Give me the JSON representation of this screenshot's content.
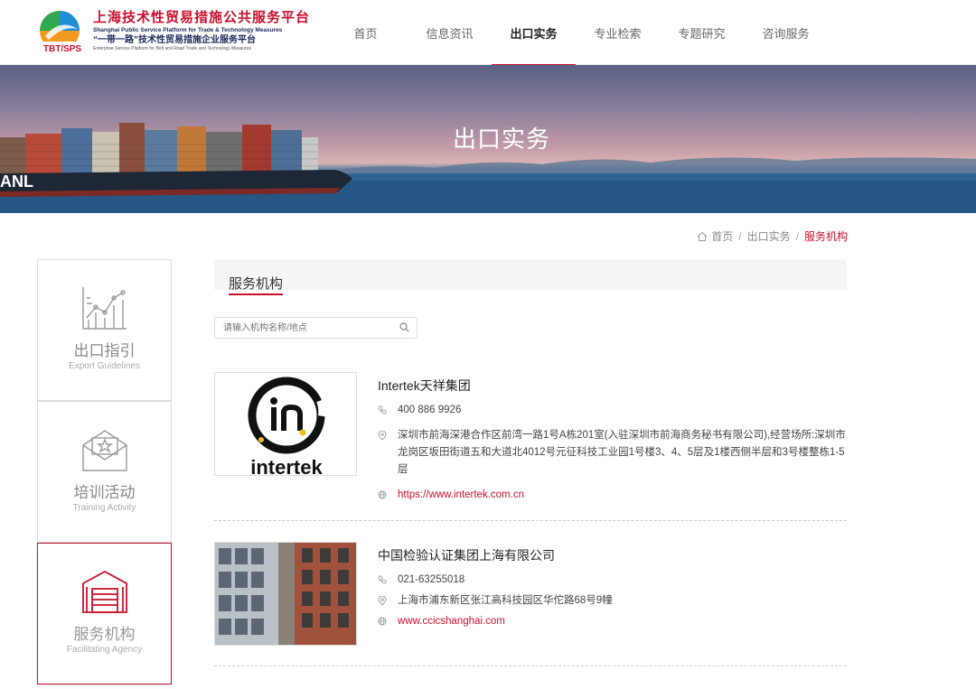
{
  "logo": {
    "cn": "上海技术性贸易措施公共服务平台",
    "en1": "Shanghai Public Service Platform for Trade & Technology Measures",
    "cn2": "“一带一路”技术性贸易措施企业服务平台",
    "en2": "Enterprise Service Platform for Belt and Road Trade and Technology Measures",
    "mark": "TBT/SPS"
  },
  "nav": [
    {
      "label": "首页"
    },
    {
      "label": "信息资讯"
    },
    {
      "label": "出口实务",
      "active": true
    },
    {
      "label": "专业检索"
    },
    {
      "label": "专题研究"
    },
    {
      "label": "咨询服务"
    }
  ],
  "banner": {
    "title": "出口实务",
    "ship_brand": "ANL"
  },
  "breadcrumb": {
    "home": "首页",
    "parent": "出口实务",
    "current": "服务机构",
    "sep": "/"
  },
  "sidebar": [
    {
      "cn": "出口指引",
      "en": "Export Guidelines",
      "icon": "chart-icon"
    },
    {
      "cn": "培训活动",
      "en": "Training Activity",
      "icon": "envelope-star-icon"
    },
    {
      "cn": "服务机构",
      "en": "Facilitating Agency",
      "icon": "warehouse-icon",
      "active": true
    }
  ],
  "section": {
    "title": "服务机构"
  },
  "search": {
    "placeholder": "请输入机构名称/地点"
  },
  "agencies": [
    {
      "name": "Intertek天祥集团",
      "phone": "400 886 9926",
      "address": "深圳市前海深港合作区前湾一路1号A栋201室(入驻深圳市前海商务秘书有限公司),经营场所:深圳市龙岗区坂田街道五和大道北4012号元征科技工业园1号楼3、4、5层及1楼西侧半层和3号楼整栋1-5层",
      "url": "https://www.intertek.com.cn",
      "logo_text": "intertek"
    },
    {
      "name": "中国检验认证集团上海有限公司",
      "phone": "021-63255018",
      "address": "上海市浦东新区张江高科技园区华佗路68号9幢",
      "url": "www.ccicshanghai.com"
    }
  ],
  "colors": {
    "accent": "#c8102e",
    "nav_text": "#666666",
    "muted": "#888888"
  }
}
